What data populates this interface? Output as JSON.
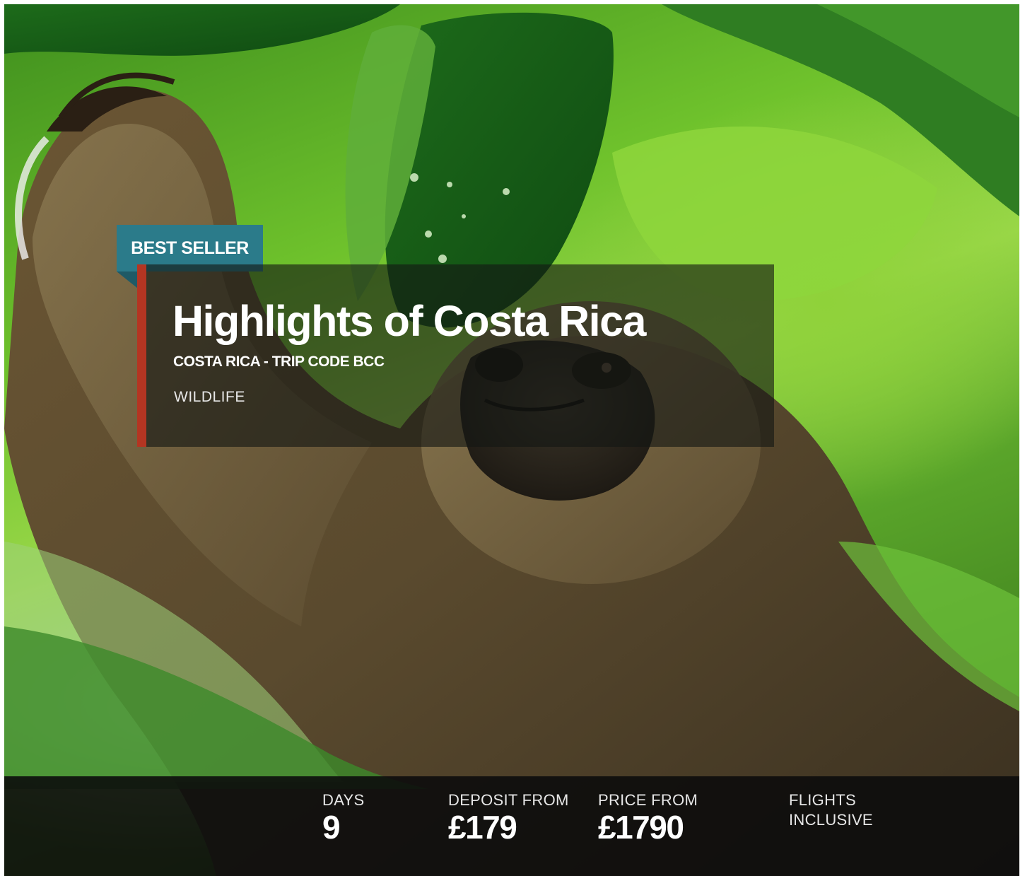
{
  "badge": {
    "label": "BEST SELLER"
  },
  "trip": {
    "title": "Highlights of Costa Rica",
    "subtitle": "COSTA RICA - TRIP CODE BCC",
    "category": "WILDLIFE"
  },
  "stats": {
    "days": {
      "label": "DAYS",
      "value": "9"
    },
    "deposit": {
      "label": "DEPOSIT FROM",
      "value": "£179"
    },
    "price": {
      "label": "PRICE FROM",
      "value": "£1790"
    },
    "flights": {
      "label": "FLIGHTS INCLUSIVE"
    }
  },
  "colors": {
    "badge": "#2b7b8a",
    "accent_border": "#b43522",
    "card_overlay": "rgba(20,22,20,0.62)",
    "info_bar": "#0c0c0c"
  },
  "hero_image": {
    "subject": "sloth-in-foliage"
  }
}
